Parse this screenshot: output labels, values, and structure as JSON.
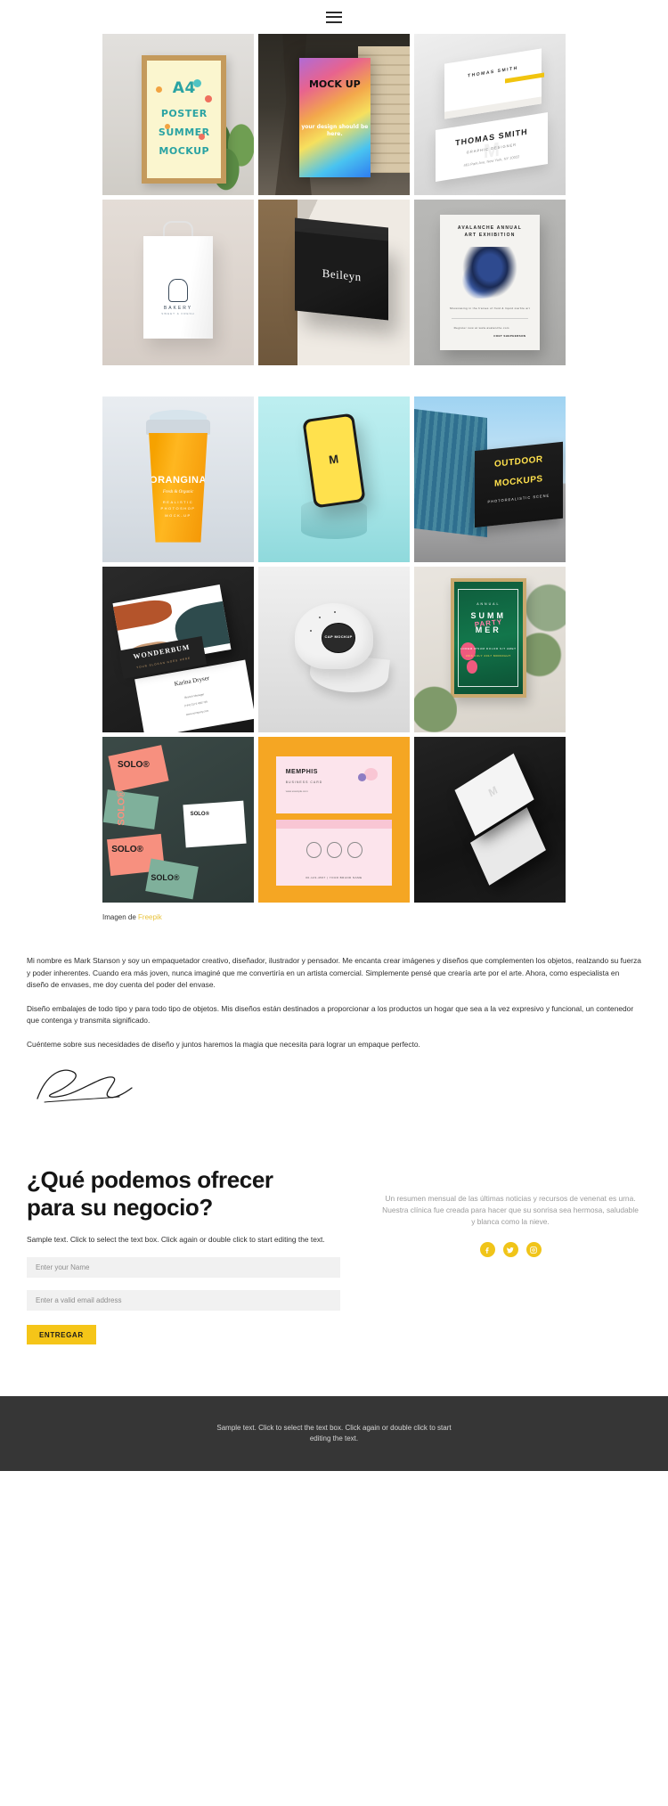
{
  "header": {
    "menu_icon": "hamburger-menu-icon"
  },
  "gallery": {
    "sections": [
      {
        "rows": [
          [
            {
              "name": "a4-poster-summer-mockup",
              "kind": "a4",
              "lines": [
                "A4",
                "POSTER",
                "SUMMER",
                "MOCKUP"
              ]
            },
            {
              "name": "billboard-mockup",
              "kind": "billboard",
              "title": "MOCK UP",
              "sub": "your design should be here."
            },
            {
              "name": "business-card-stack-thomas-smith",
              "kind": "bizcard",
              "stack_name": "THOMAS SMITH",
              "name_line": "THOMAS SMITH",
              "role": "GRAPHIC DESIGNER",
              "address": "461 Park Ave, New York, NY 10022"
            }
          ],
          [
            {
              "name": "paper-bag-bakery-mockup",
              "kind": "bag",
              "brand": "BAKERY",
              "tagline": "SWEET & FRESH"
            },
            {
              "name": "black-shopping-bag-beileyn",
              "kind": "blackbag",
              "brand": "Beileyn"
            },
            {
              "name": "art-exhibition-poster",
              "kind": "exhibition",
              "line1": "AVALANCHE ANNUAL",
              "line2": "ART EXHIBITION",
              "blurb": "Showcasing in the frames of fluid & liquid marble art",
              "contact": "Register now at www.avalanche.com",
              "signature": "COET SHEPHERSON"
            }
          ]
        ]
      },
      {
        "rows": [
          [
            {
              "name": "orangina-cup-mockup",
              "kind": "cup",
              "brand": "ORANGINA",
              "tagline": "Fresh & Organic",
              "l1": "REALISTIC",
              "l2": "PHOTOSHOP",
              "l3": "MOCK-UP"
            },
            {
              "name": "phone-podium-mockup",
              "kind": "phone",
              "screen_logo": "M"
            },
            {
              "name": "outdoor-billboard-mockup",
              "kind": "outdoor",
              "l1": "OUTDOOR",
              "l2": "MOCKUPS",
              "l3": "PHOTOREALISTIC SCENE"
            }
          ],
          [
            {
              "name": "wonderbum-business-cards",
              "kind": "wonderbum",
              "brand": "WONDERBUM",
              "slogan": "YOUR SLOGAN GOES HERE",
              "person": "Karina Dryser",
              "role": "Branch Manager",
              "phone": "(+44) 0173 4567 89",
              "site": "www.company.com"
            },
            {
              "name": "cap-mockup",
              "kind": "cap",
              "badge": "CAP MOCKUP"
            },
            {
              "name": "summer-party-poster",
              "kind": "summer",
              "annual": "ANNUAL",
              "l1": "SUMM",
              "l2": "MER",
              "party": "PARTY",
              "detail": "LOREM IPSUM DOLOR SIT AMET",
              "date": "20th JULY 2017 MIDNIGHT"
            }
          ],
          [
            {
              "name": "solo-brand-cards",
              "kind": "solo",
              "brand": "SOLO®"
            },
            {
              "name": "memphis-business-cards",
              "kind": "memphis",
              "brand": "MEMPHIS",
              "sub": "BUSINESS CARD",
              "url": "www.example.com",
              "footer": "00-123-4567  |  YOUR BRAND NAME"
            },
            {
              "name": "dark-folded-card-mockup",
              "kind": "dark",
              "logo": "M"
            }
          ]
        ]
      }
    ]
  },
  "credit": {
    "prefix": "Imagen de ",
    "link_label": "Freepik"
  },
  "article": {
    "paragraphs": [
      "Mi nombre es Mark Stanson y soy un empaquetador creativo, diseñador, ilustrador y pensador. Me encanta crear imágenes y diseños que complementen los objetos, realzando su fuerza y poder inherentes. Cuando era más joven, nunca imaginé que me convertiría en un artista comercial. Simplemente pensé que crearía arte por el arte. Ahora, como especialista en diseño de envases, me doy cuenta del poder del envase.",
      "Diseño embalajes de todo tipo y para todo tipo de objetos. Mis diseños están destinados a proporcionar a los productos un hogar que sea a la vez expresivo y funcional, un contenedor que contenga y transmita significado.",
      "Cuénteme sobre sus necesidades de diseño y juntos haremos la magia que necesita para lograr un empaque perfecto."
    ],
    "signature_alt": "handwritten-signature"
  },
  "offer": {
    "title_line1": "¿Qué podemos ofrecer",
    "title_line2": "para su negocio?",
    "subtitle": "Sample text. Click to select the text box. Click again or double click to start editing the text.",
    "name_placeholder": "Enter your Name",
    "email_placeholder": "Enter a valid email address",
    "submit_label": "ENTREGAR",
    "side_text": "Un resumen mensual de las últimas noticias y recursos de venenat es urna. Nuestra clínica fue creada para hacer que su sonrisa sea hermosa, saludable y blanca como la nieve.",
    "socials": [
      {
        "name": "facebook-icon",
        "label": "Facebook"
      },
      {
        "name": "twitter-icon",
        "label": "Twitter"
      },
      {
        "name": "instagram-icon",
        "label": "Instagram"
      }
    ],
    "accent_color": "#f5c518"
  },
  "footer": {
    "text": "Sample text. Click to select the text box. Click again or double click to start editing the text.",
    "background": "#363636"
  }
}
